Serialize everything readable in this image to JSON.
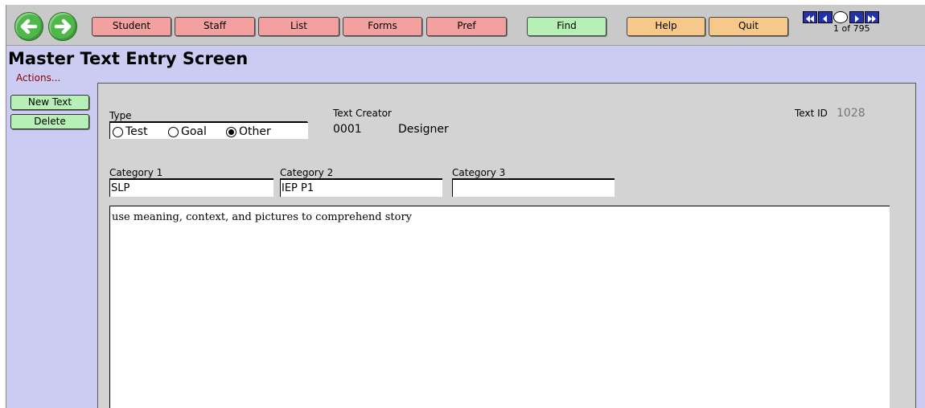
{
  "toolbar": {
    "buttons": [
      "Student",
      "Staff",
      "List",
      "Forms",
      "Pref",
      "Find",
      "Help",
      "Quit"
    ],
    "record_count": "1 of 795"
  },
  "colors": {
    "pink": "#f2a0a0",
    "green": "#b6f0b6",
    "orange": "#f6c88a",
    "background": "#ccccf2",
    "panel": "#d3d3d3"
  },
  "icons": [
    "arrow-left-icon",
    "arrow-right-icon",
    "first-record-icon",
    "previous-record-icon",
    "record-slider-icon",
    "next-record-icon",
    "last-record-icon"
  ],
  "page": {
    "title": "Master Text Entry Screen"
  },
  "actions": {
    "label": "Actions...",
    "new_text": "New Text",
    "delete": "Delete"
  },
  "form": {
    "type_label": "Type",
    "type_options": [
      "Test",
      "Goal",
      "Other"
    ],
    "type_selected": "Other",
    "creator_label": "Text Creator",
    "creator_id": "0001",
    "creator_name": "Designer",
    "text_id_label": "Text ID",
    "text_id": "1028",
    "category1_label": "Category 1",
    "category1": "SLP",
    "category2_label": "Category 2",
    "category2": "IEP P1",
    "category3_label": "Category 3",
    "category3": "",
    "body": "use meaning, context, and pictures to comprehend story"
  }
}
